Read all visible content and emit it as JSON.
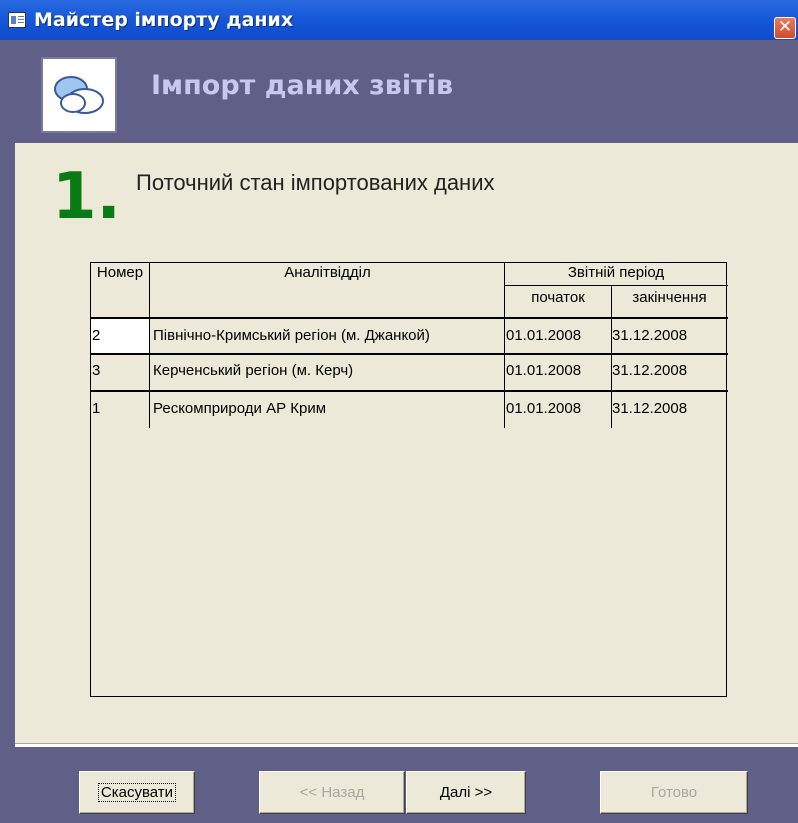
{
  "window": {
    "title": "Майстер імпорту даних",
    "close_glyph": "✕"
  },
  "header": {
    "title": "Імпорт даних звітів",
    "logo_icon": "clouds-icon"
  },
  "step": {
    "number": "1.",
    "text": "Поточний стан імпортованих даних"
  },
  "table": {
    "col_number": "Номер",
    "col_department": "Аналітвідділ",
    "col_period": "Звітній період",
    "col_start": "початок",
    "col_end": "закінчення",
    "rows": [
      {
        "number": "2",
        "department": "Північно-Кримський регіон (м. Джанкой)",
        "start": "01.01.2008",
        "end": "31.12.2008"
      },
      {
        "number": "3",
        "department": "Керченський регіон (м. Керч)",
        "start": "01.01.2008",
        "end": "31.12.2008"
      },
      {
        "number": "1",
        "department": "Рескомприроди АР Крим",
        "start": "01.01.2008",
        "end": "31.12.2008"
      }
    ]
  },
  "buttons": {
    "cancel": "Скасувати",
    "back": "<< Назад",
    "next": "Далі >>",
    "finish": "Готово"
  },
  "colors": {
    "accent_green": "#0a7a14",
    "band": "#5f5f87",
    "panel": "#ece9d8"
  }
}
